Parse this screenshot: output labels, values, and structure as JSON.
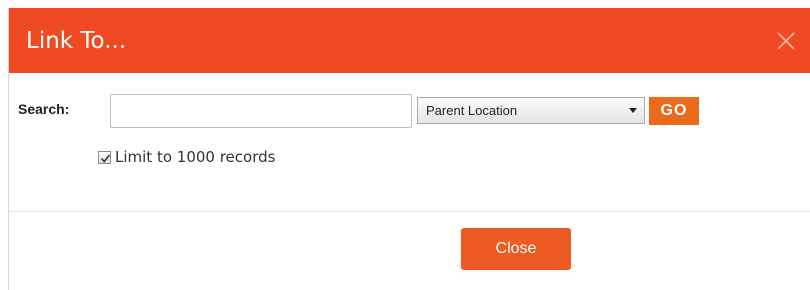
{
  "dialog": {
    "title": "Link To...",
    "header_color": "#f04a23",
    "close_icon": "close-icon"
  },
  "search": {
    "label": "Search:",
    "input_value": "",
    "input_placeholder": "",
    "select_value": "Parent Location",
    "select_icon": "chevron-down-icon",
    "go_label": "GO",
    "go_color": "#ec6a1c"
  },
  "limit": {
    "checked": true,
    "label": "Limit to 1000 records",
    "check_icon": "checkmark-icon"
  },
  "footer": {
    "close_label": "Close",
    "close_color": "#ee5a24"
  }
}
